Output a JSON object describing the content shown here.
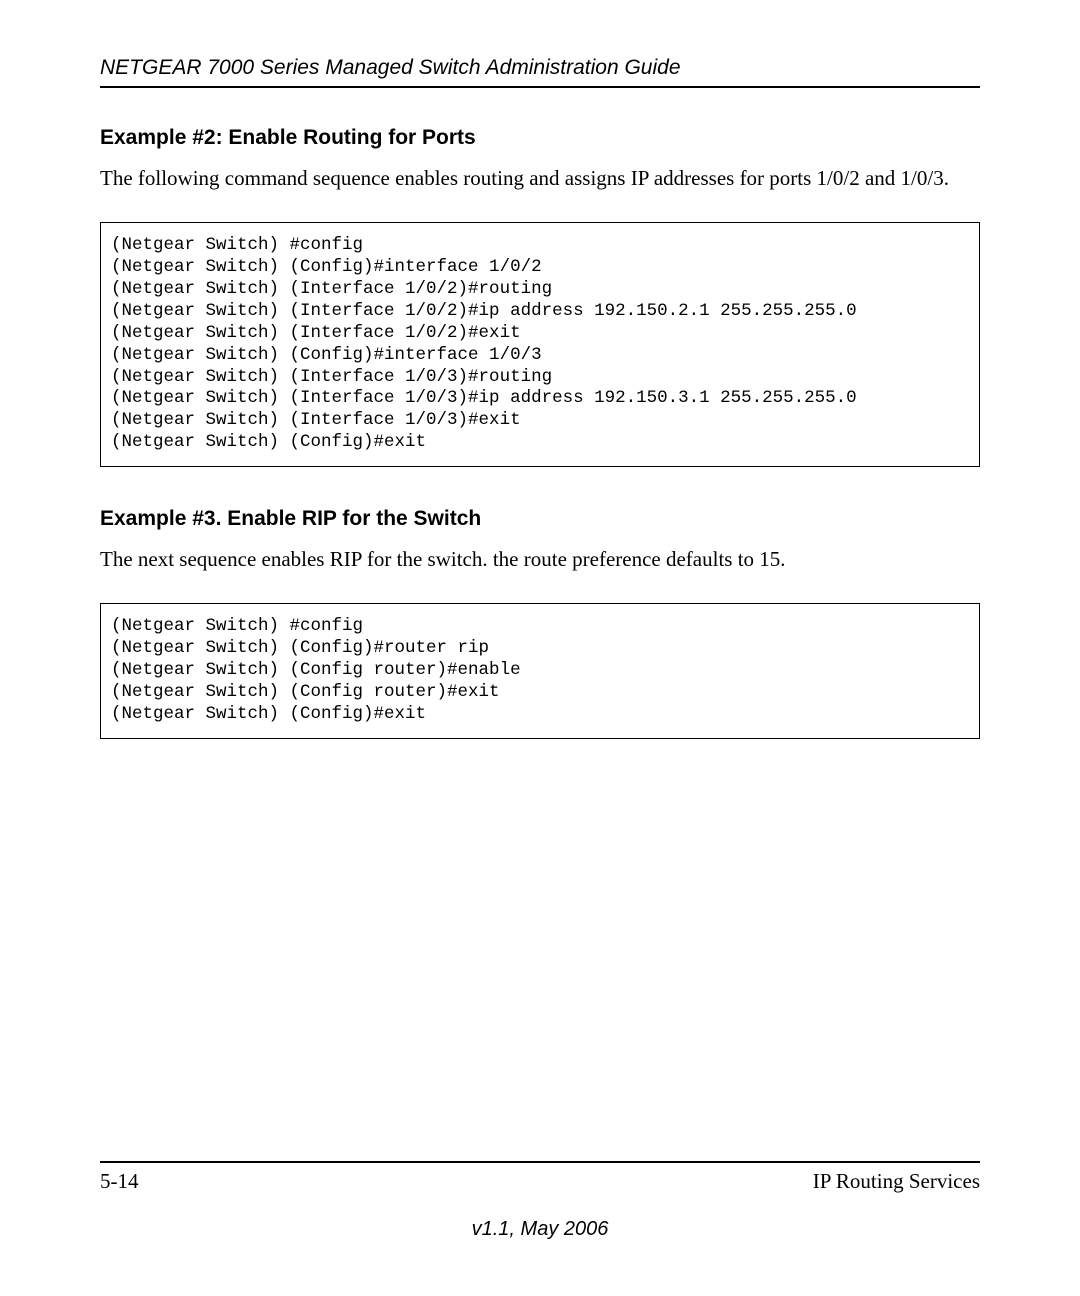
{
  "header": {
    "title": "NETGEAR 7000  Series Managed Switch Administration Guide"
  },
  "sections": [
    {
      "heading": "Example #2: Enable Routing for Ports",
      "body": "The following command sequence enables routing and assigns IP addresses for ports 1/0/2 and 1/0/3.",
      "code": "(Netgear Switch) #config\n(Netgear Switch) (Config)#interface 1/0/2\n(Netgear Switch) (Interface 1/0/2)#routing\n(Netgear Switch) (Interface 1/0/2)#ip address 192.150.2.1 255.255.255.0\n(Netgear Switch) (Interface 1/0/2)#exit\n(Netgear Switch) (Config)#interface 1/0/3\n(Netgear Switch) (Interface 1/0/3)#routing\n(Netgear Switch) (Interface 1/0/3)#ip address 192.150.3.1 255.255.255.0\n(Netgear Switch) (Interface 1/0/3)#exit\n(Netgear Switch) (Config)#exit"
    },
    {
      "heading": "Example #3. Enable RIP for the Switch",
      "body": "The next sequence enables RIP for the switch. the route preference defaults to 15.",
      "code": "(Netgear Switch) #config\n(Netgear Switch) (Config)#router rip\n(Netgear Switch) (Config router)#enable\n(Netgear Switch) (Config router)#exit\n(Netgear Switch) (Config)#exit"
    }
  ],
  "footer": {
    "page_number": "5-14",
    "section_name": "IP Routing Services",
    "version": "v1.1, May 2006"
  }
}
